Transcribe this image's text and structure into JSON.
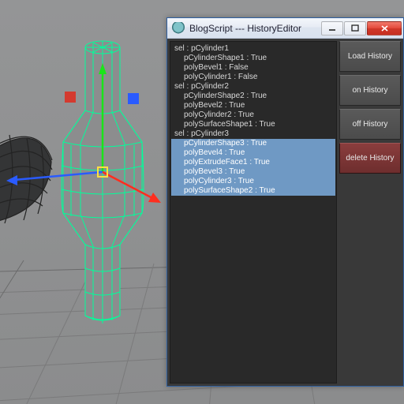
{
  "window": {
    "title": "BlogScript --- HistoryEditor"
  },
  "buttons": {
    "load": "Load History",
    "on": "on  History",
    "off": "off History",
    "delete": "delete History"
  },
  "history": [
    {
      "text": "sel : pCylinder1",
      "indent": false,
      "selected": false
    },
    {
      "text": "pCylinderShape1 : True",
      "indent": true,
      "selected": false
    },
    {
      "text": "polyBevel1 : False",
      "indent": true,
      "selected": false
    },
    {
      "text": "polyCylinder1 : False",
      "indent": true,
      "selected": false
    },
    {
      "text": "sel : pCylinder2",
      "indent": false,
      "selected": false
    },
    {
      "text": "pCylinderShape2 : True",
      "indent": true,
      "selected": false
    },
    {
      "text": "polyBevel2 : True",
      "indent": true,
      "selected": false
    },
    {
      "text": "polyCylinder2 : True",
      "indent": true,
      "selected": false
    },
    {
      "text": "polySurfaceShape1 : True",
      "indent": true,
      "selected": false
    },
    {
      "text": "sel : pCylinder3",
      "indent": false,
      "selected": false
    },
    {
      "text": "pCylinderShape3 : True",
      "indent": true,
      "selected": true
    },
    {
      "text": "polyBevel4 : True",
      "indent": true,
      "selected": true
    },
    {
      "text": "polyExtrudeFace1 : True",
      "indent": true,
      "selected": true
    },
    {
      "text": "polyBevel3 : True",
      "indent": true,
      "selected": true
    },
    {
      "text": "polyCylinder3 : True",
      "indent": true,
      "selected": true
    },
    {
      "text": "polySurfaceShape2 : True",
      "indent": true,
      "selected": true
    }
  ],
  "colors": {
    "selected_bg": "#6f99c4",
    "mesh_selected": "#00ff9a",
    "delete_btn": "#6e2e2e"
  }
}
